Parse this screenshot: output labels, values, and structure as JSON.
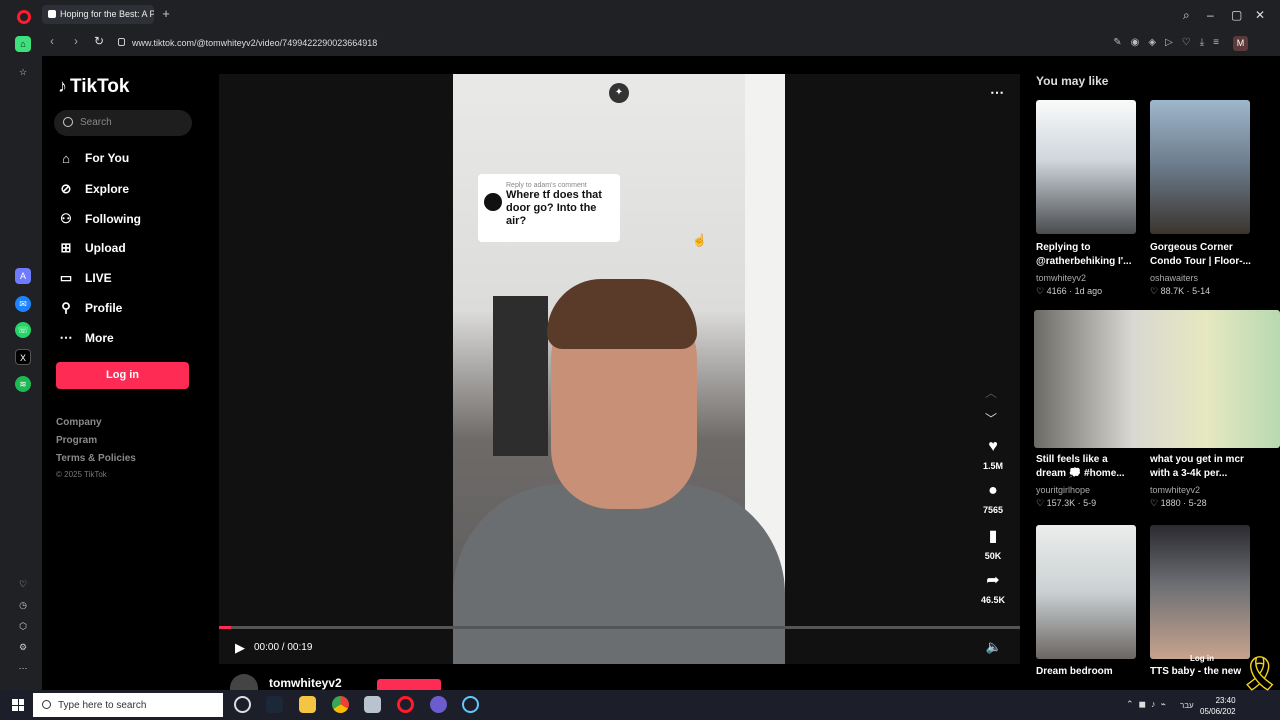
{
  "browser": {
    "tab_title": "Hoping for the Best: A Pe",
    "url": "www.tiktok.com/@tomwhiteyv2/video/7499422290023664918",
    "profile_initial": "M",
    "new_tab": "+",
    "window_controls": [
      "⌕",
      "–",
      "▢",
      "✕"
    ],
    "url_icons": "✎◉◈▷♡⤓≡"
  },
  "sidebar": {
    "logo": "TikTok",
    "search_placeholder": "Search",
    "nav": [
      {
        "label": "For You",
        "icon": "home-icon"
      },
      {
        "label": "Explore",
        "icon": "compass-icon"
      },
      {
        "label": "Following",
        "icon": "following-icon"
      },
      {
        "label": "Upload",
        "icon": "upload-icon"
      },
      {
        "label": "LIVE",
        "icon": "live-icon"
      },
      {
        "label": "Profile",
        "icon": "profile-icon"
      },
      {
        "label": "More",
        "icon": "more-icon"
      }
    ],
    "login": "Log in",
    "footer": [
      "Company",
      "Program",
      "Terms & Policies"
    ],
    "copyright": "© 2025 TikTok"
  },
  "player": {
    "comment_reply": "Reply to adam's comment",
    "comment_text": "Where tf does that door go? Into the air?",
    "time": "00:00 / 00:19",
    "progress": 0.015,
    "likes": "1.5M",
    "comments": "7565",
    "saves": "50K",
    "shares": "46.5K",
    "author": "tomwhiteyv2"
  },
  "recommendations": {
    "heading": "You may like",
    "items": [
      {
        "title": "Replying to @ratherbehiking I'...",
        "author": "tomwhiteyv2",
        "stats": "♡ 4166 · 1d ago"
      },
      {
        "title": "Gorgeous Corner Condo Tour | Floor-...",
        "author": "oshawaiters",
        "stats": "♡ 88.7K · 5-14"
      },
      {
        "title": "Still feels like a dream 💭 #home...",
        "author": "youritgirlhope",
        "stats": "♡ 157.3K · 5-9"
      },
      {
        "title": "what you get in mcr with a 3-4k per...",
        "author": "tomwhiteyv2",
        "stats": "♡ 1880 · 5-28"
      },
      {
        "title": "Dream bedroom",
        "author": "",
        "stats": ""
      },
      {
        "title": "TTS baby - the new",
        "author": "",
        "stats": ""
      }
    ],
    "overlay_login": "Log in"
  },
  "taskbar": {
    "search_placeholder": "Type here to search",
    "time": "23:40",
    "date": "05/06/202",
    "lang": "עבר"
  },
  "colors": {
    "accent": "#fe2c55",
    "background": "#000000"
  }
}
